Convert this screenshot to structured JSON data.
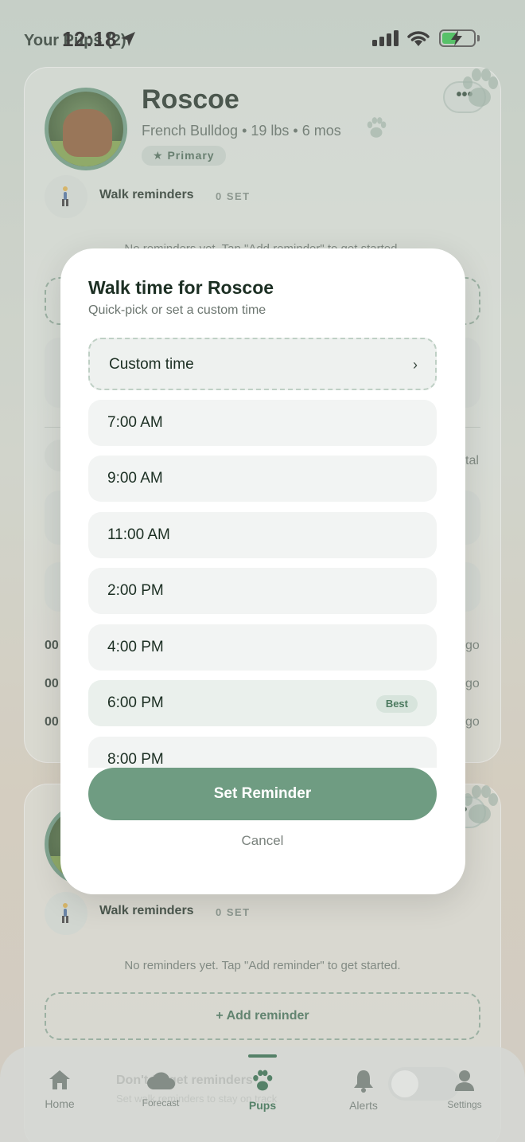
{
  "status_bar": {
    "time": "12:18",
    "background_title": "Your Pups (2)"
  },
  "pups": [
    {
      "name": "Roscoe",
      "meta": "French Bulldog • 19 lbs • 6 mos",
      "badge": "★ Primary",
      "walk_reminders_title": "Walk reminders",
      "walk_reminders_count": "0 SET",
      "empty_text": "No reminders yet. Tap \"Add reminder\" to get started.",
      "row_fragments": [
        "00",
        "00",
        "00"
      ],
      "row_tails": [
        "go",
        "go",
        "go"
      ],
      "side_fragment": "tal"
    },
    {
      "walk_reminders_title": "Walk reminders",
      "walk_reminders_count": "0 SET",
      "empty_text": "No reminders yet. Tap \"Add reminder\" to get started.",
      "add_reminder_label": "+ Add reminder"
    }
  ],
  "banner": {
    "title": "Don't forget reminders",
    "subtitle": "Set walk reminders to stay on track"
  },
  "modal": {
    "title": "Walk time for Roscoe",
    "subtitle": "Quick-pick or set a custom time",
    "custom_option": "Custom time",
    "time_options": [
      {
        "label": "7:00 AM",
        "badge": ""
      },
      {
        "label": "9:00 AM",
        "badge": ""
      },
      {
        "label": "11:00 AM",
        "badge": ""
      },
      {
        "label": "2:00 PM",
        "badge": ""
      },
      {
        "label": "4:00 PM",
        "badge": ""
      },
      {
        "label": "6:00 PM",
        "badge": "Best"
      },
      {
        "label": "8:00 PM",
        "badge": ""
      }
    ],
    "set_button": "Set Reminder",
    "cancel_button": "Cancel"
  },
  "tabs": [
    {
      "label": "Home",
      "icon": "home-icon",
      "active": false
    },
    {
      "label": "Forecast",
      "icon": "cloud-icon",
      "active": false
    },
    {
      "label": "Pups",
      "icon": "paw-icon",
      "active": true
    },
    {
      "label": "Alerts",
      "icon": "bell-icon",
      "active": false
    },
    {
      "label": "Settings",
      "icon": "person-icon",
      "active": false
    }
  ],
  "colors": {
    "accent": "#6f9c82",
    "accent_dark": "#2d6a48",
    "modal_bg": "#ffffff",
    "option_bg": "#f2f4f3"
  }
}
